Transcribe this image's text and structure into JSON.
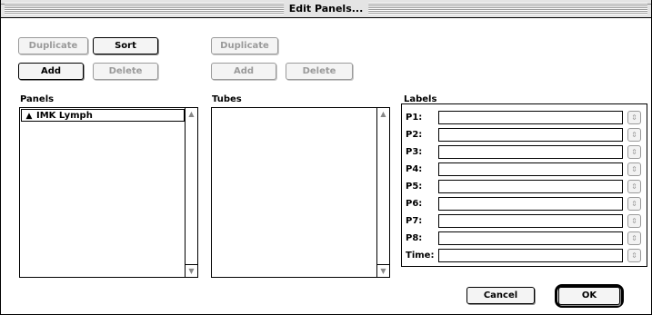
{
  "window": {
    "title": "Edit Panels..."
  },
  "panels_section": {
    "duplicate_label": "Duplicate",
    "sort_label": "Sort",
    "add_label": "Add",
    "delete_label": "Delete",
    "list_label": "Panels",
    "items": [
      {
        "label": "IMK Lymph",
        "icon": "sort-arrows-icon"
      }
    ]
  },
  "tubes_section": {
    "duplicate_label": "Duplicate",
    "add_label": "Add",
    "delete_label": "Delete",
    "list_label": "Tubes",
    "items": []
  },
  "labels_section": {
    "title": "Labels",
    "rows": [
      {
        "label": "P1:",
        "value": ""
      },
      {
        "label": "P2:",
        "value": ""
      },
      {
        "label": "P3:",
        "value": ""
      },
      {
        "label": "P4:",
        "value": ""
      },
      {
        "label": "P5:",
        "value": ""
      },
      {
        "label": "P6:",
        "value": ""
      },
      {
        "label": "P7:",
        "value": ""
      },
      {
        "label": "P8:",
        "value": ""
      },
      {
        "label": "Time:",
        "value": ""
      }
    ],
    "stepper_icon": "up-down-stepper-icon"
  },
  "footer": {
    "cancel_label": "Cancel",
    "ok_label": "OK"
  },
  "colors": {
    "disabled": "#9a9a9a",
    "border": "#000000",
    "background": "#ffffff"
  }
}
